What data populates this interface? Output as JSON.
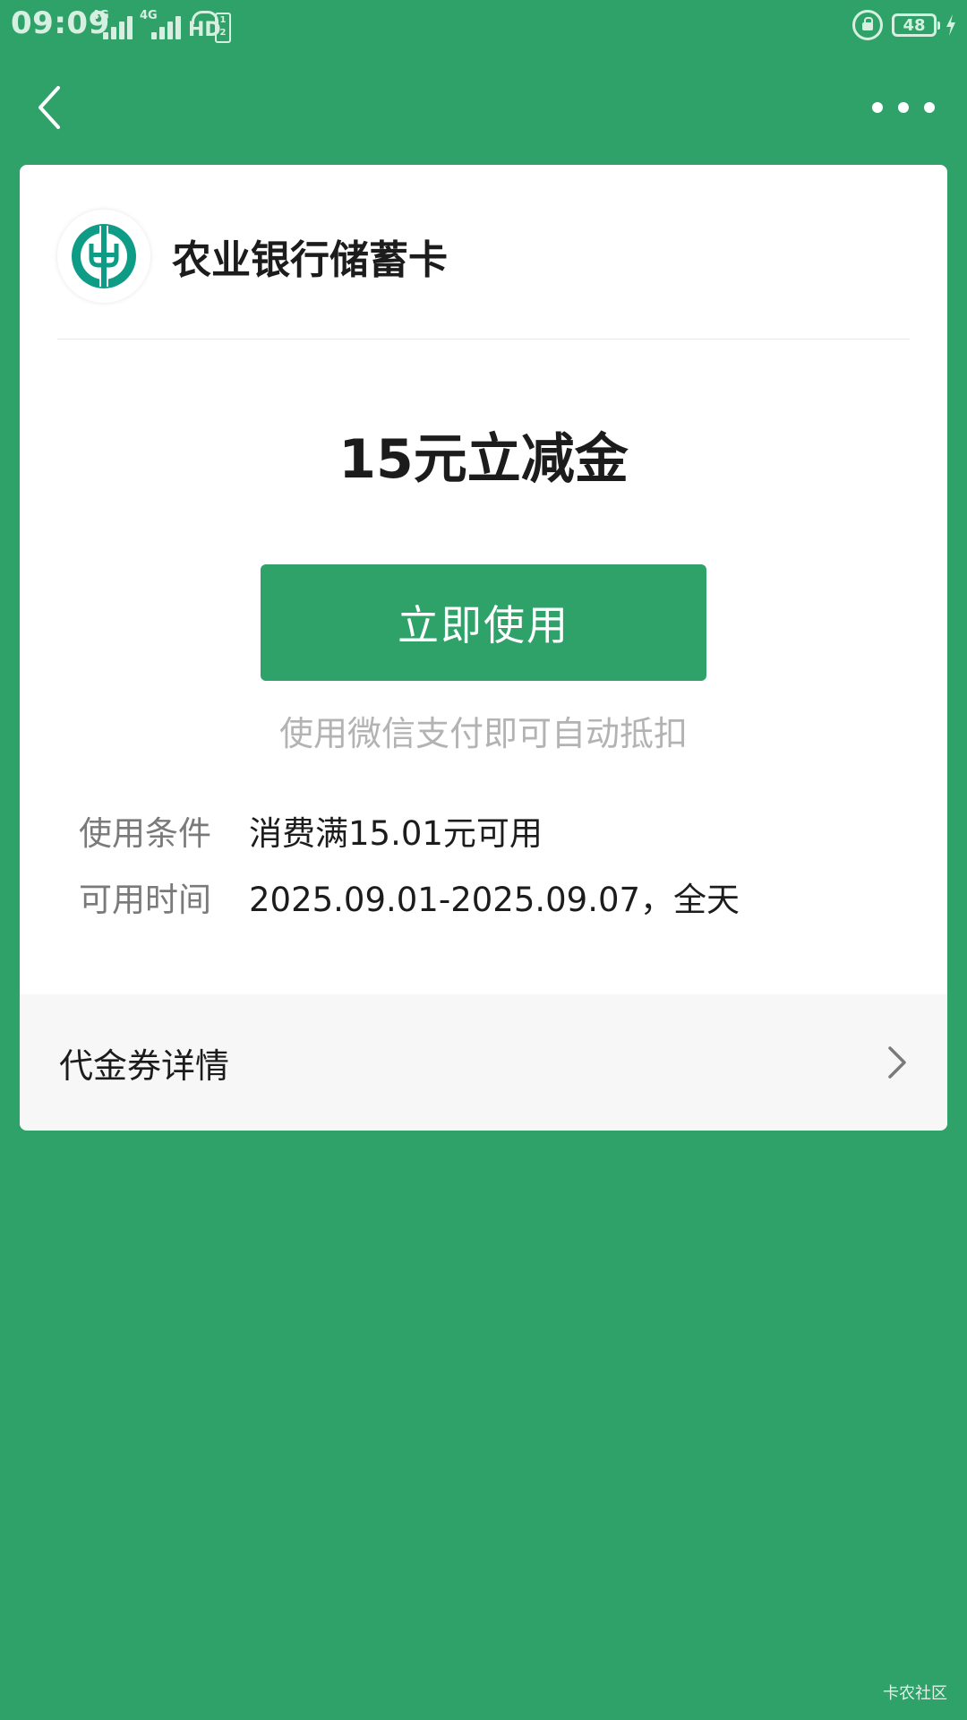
{
  "status_bar": {
    "time": "09:09",
    "network_1": "4G",
    "network_2": "4G",
    "hd_label": "HD",
    "sim_label": "1 2",
    "battery_level": "48"
  },
  "nav": {
    "back_icon": "chevron-left-icon",
    "more_icon": "more-dots-icon"
  },
  "card": {
    "bank_name": "农业银行储蓄卡",
    "coupon_title": "15元立减金",
    "use_button_label": "立即使用",
    "use_hint": "使用微信支付即可自动抵扣",
    "conditions": [
      {
        "label": "使用条件",
        "value": "消费满15.01元可用"
      },
      {
        "label": "可用时间",
        "value": "2025.09.01-2025.09.07，全天"
      }
    ],
    "details_label": "代金券详情"
  },
  "watermark": "卡农社区",
  "colors": {
    "brand_green": "#2ea268",
    "logo_teal": "#0f9c86"
  }
}
